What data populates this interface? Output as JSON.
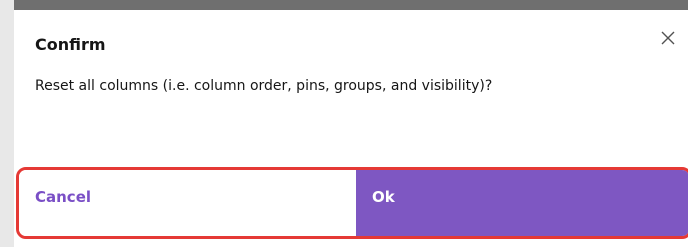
{
  "dialog": {
    "title": "Confirm",
    "message": "Reset all columns (i.e. column order, pins, groups, and visibility)?",
    "close_icon": "close-icon",
    "buttons": {
      "cancel_label": "Cancel",
      "ok_label": "Ok"
    }
  },
  "colors": {
    "primary": "#7e57c2",
    "cancel_text": "#7a4fc6",
    "highlight_border": "#e53935"
  }
}
